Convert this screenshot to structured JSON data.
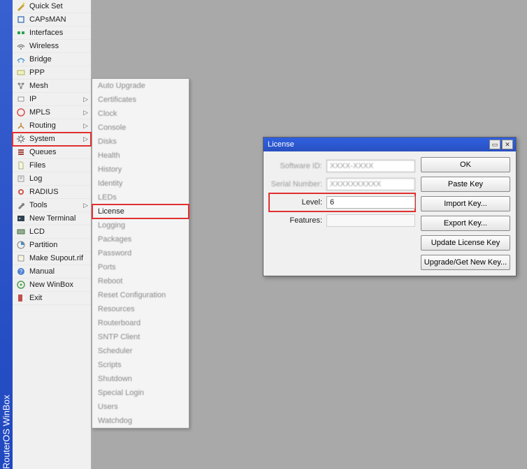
{
  "app_title": "RouterOS WinBox",
  "sidebar": {
    "items": [
      {
        "label": "Quick Set",
        "icon": "wand",
        "arrow": false
      },
      {
        "label": "CAPsMAN",
        "icon": "cap",
        "arrow": false
      },
      {
        "label": "Interfaces",
        "icon": "interfaces",
        "arrow": false
      },
      {
        "label": "Wireless",
        "icon": "wireless",
        "arrow": false
      },
      {
        "label": "Bridge",
        "icon": "bridge",
        "arrow": false
      },
      {
        "label": "PPP",
        "icon": "ppp",
        "arrow": false
      },
      {
        "label": "Mesh",
        "icon": "mesh",
        "arrow": false
      },
      {
        "label": "IP",
        "icon": "ip",
        "arrow": true
      },
      {
        "label": "MPLS",
        "icon": "mpls",
        "arrow": true
      },
      {
        "label": "Routing",
        "icon": "routing",
        "arrow": true
      },
      {
        "label": "System",
        "icon": "system",
        "arrow": true,
        "highlighted": true
      },
      {
        "label": "Queues",
        "icon": "queues",
        "arrow": false
      },
      {
        "label": "Files",
        "icon": "files",
        "arrow": false
      },
      {
        "label": "Log",
        "icon": "log",
        "arrow": false
      },
      {
        "label": "RADIUS",
        "icon": "radius",
        "arrow": false
      },
      {
        "label": "Tools",
        "icon": "tools",
        "arrow": true
      },
      {
        "label": "New Terminal",
        "icon": "terminal",
        "arrow": false
      },
      {
        "label": "LCD",
        "icon": "lcd",
        "arrow": false
      },
      {
        "label": "Partition",
        "icon": "partition",
        "arrow": false
      },
      {
        "label": "Make Supout.rif",
        "icon": "supout",
        "arrow": false
      },
      {
        "label": "Manual",
        "icon": "manual",
        "arrow": false
      },
      {
        "label": "New WinBox",
        "icon": "winbox",
        "arrow": false
      },
      {
        "label": "Exit",
        "icon": "exit",
        "arrow": false
      }
    ]
  },
  "submenu": {
    "items": [
      {
        "label": "Auto Upgrade"
      },
      {
        "label": "Certificates"
      },
      {
        "label": "Clock"
      },
      {
        "label": "Console"
      },
      {
        "label": "Disks"
      },
      {
        "label": "Health"
      },
      {
        "label": "History"
      },
      {
        "label": "Identity"
      },
      {
        "label": "LEDs"
      },
      {
        "label": "License",
        "highlighted": true,
        "sharp": true
      },
      {
        "label": "Logging"
      },
      {
        "label": "Packages"
      },
      {
        "label": "Password"
      },
      {
        "label": "Ports"
      },
      {
        "label": "Reboot"
      },
      {
        "label": "Reset Configuration"
      },
      {
        "label": "Resources"
      },
      {
        "label": "Routerboard"
      },
      {
        "label": "SNTP Client"
      },
      {
        "label": "Scheduler"
      },
      {
        "label": "Scripts"
      },
      {
        "label": "Shutdown"
      },
      {
        "label": "Special Login"
      },
      {
        "label": "Users"
      },
      {
        "label": "Watchdog"
      }
    ]
  },
  "dialog": {
    "title": "License",
    "fields": {
      "software_id_label": "Software ID:",
      "software_id_value": "XXXX-XXXX",
      "serial_label": "Serial Number:",
      "serial_value": "XXXXXXXXXX",
      "level_label": "Level:",
      "level_value": "6",
      "features_label": "Features:"
    },
    "buttons": {
      "ok": "OK",
      "paste": "Paste Key",
      "import": "Import Key...",
      "export": "Export Key...",
      "update": "Update License Key",
      "upgrade": "Upgrade/Get New Key..."
    }
  }
}
